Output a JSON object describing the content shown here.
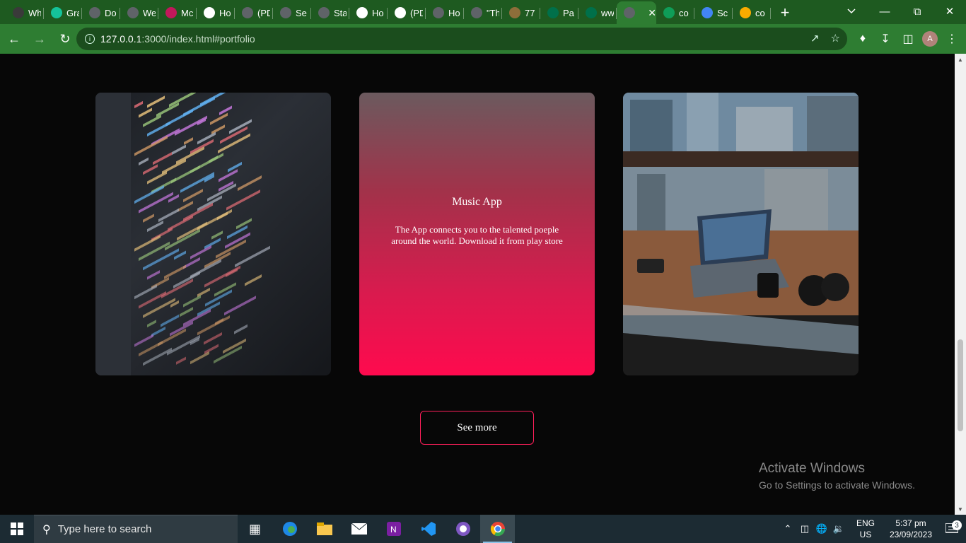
{
  "browser": {
    "tabs": [
      {
        "title": "Wh",
        "icon": "chrome-icon",
        "color": "#3a3a3a"
      },
      {
        "title": "Gra",
        "icon": "grammarly-icon",
        "color": "#15c39a"
      },
      {
        "title": "Do",
        "icon": "globe-icon",
        "color": "#5f6368"
      },
      {
        "title": "We",
        "icon": "globe-icon",
        "color": "#5f6368"
      },
      {
        "title": "Mc",
        "icon": "mc-icon",
        "color": "#c2185b"
      },
      {
        "title": "Ho",
        "icon": "sheet-icon",
        "color": "#ffffff"
      },
      {
        "title": "(PD",
        "icon": "globe-icon",
        "color": "#5f6368"
      },
      {
        "title": "Se",
        "icon": "globe-icon",
        "color": "#5f6368"
      },
      {
        "title": "Sta",
        "icon": "globe-icon",
        "color": "#5f6368"
      },
      {
        "title": "Ho",
        "icon": "sheet-icon",
        "color": "#ffffff"
      },
      {
        "title": "(PD",
        "icon": "researchgate-icon",
        "color": "#ffffff"
      },
      {
        "title": "Ho",
        "icon": "globe-icon",
        "color": "#5f6368"
      },
      {
        "title": "\"Th",
        "icon": "globe-icon",
        "color": "#5f6368"
      },
      {
        "title": "77",
        "icon": "emblem-icon",
        "color": "#8d6e3a"
      },
      {
        "title": "Pa",
        "icon": "starbucks-icon",
        "color": "#00704a"
      },
      {
        "title": "ww",
        "icon": "starbucks-icon",
        "color": "#00704a"
      },
      {
        "title": "",
        "icon": "globe-icon",
        "color": "#5f6368",
        "active": true
      },
      {
        "title": "co",
        "icon": "sheets-plus-icon",
        "color": "#0f9d58"
      },
      {
        "title": "Sc",
        "icon": "docs-icon",
        "color": "#4285f4"
      },
      {
        "title": "co",
        "icon": "colab-icon",
        "color": "#f9ab00"
      }
    ],
    "url_host": "127.0.0.1",
    "url_path": ":3000/index.html#portfolio",
    "avatar_letter": "A"
  },
  "page": {
    "cards": [
      {
        "title": "",
        "description": "",
        "image": "code-screen"
      },
      {
        "title": "Music App",
        "description": "The App connects you to the talented poeple around the world. Download it from play store",
        "image": "laptop-typing"
      },
      {
        "title": "",
        "description": "",
        "image": "laptop-balcony"
      }
    ],
    "see_more_label": "See more",
    "accent_color": "#ff1f5a"
  },
  "watermark": {
    "line1": "Activate Windows",
    "line2": "Go to Settings to activate Windows."
  },
  "taskbar": {
    "search_placeholder": "Type here to search",
    "lang_line1": "ENG",
    "lang_line2": "US",
    "time": "5:37 pm",
    "date": "23/09/2023",
    "notification_count": "3"
  }
}
